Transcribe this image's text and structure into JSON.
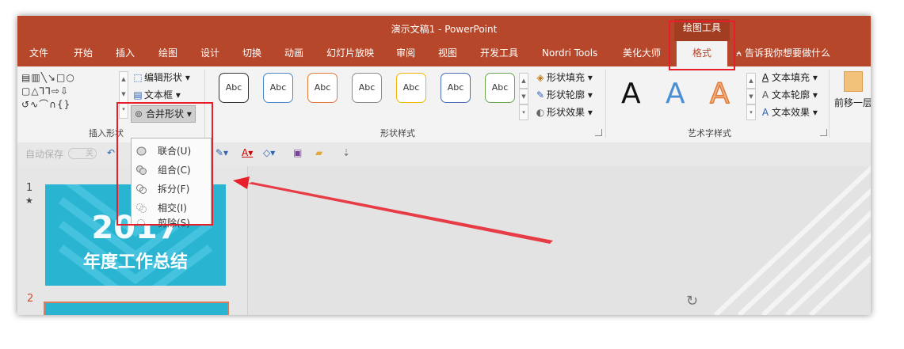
{
  "window": {
    "title": "演示文稿1  -  PowerPoint",
    "tools_header": "绘图工具"
  },
  "tabs": [
    "文件",
    "开始",
    "插入",
    "绘图",
    "设计",
    "切换",
    "动画",
    "幻灯片放映",
    "审阅",
    "视图",
    "开发工具",
    "Nordri Tools",
    "美化大师",
    "格式"
  ],
  "active_tab": "格式",
  "tell_me": "告诉我你想要做什么",
  "ribbon": {
    "insert_shapes": {
      "label": "插入形状",
      "edit_shape": "编辑形状",
      "text_box": "文本框",
      "merge_shapes": "合并形状"
    },
    "shape_styles": {
      "label": "形状样式",
      "sample": "Abc",
      "fill": "形状填充",
      "outline": "形状轮廓",
      "effects": "形状效果",
      "swatches": [
        "#333333",
        "#4a86c8",
        "#e07b39",
        "#8c8c8c",
        "#f2b600",
        "#4a6fb5",
        "#6aa84f"
      ]
    },
    "wordart_styles": {
      "label": "艺术字样式",
      "sample": "A",
      "text_fill": "文本填充",
      "text_outline": "文本轮廓",
      "text_effects": "文本效果"
    },
    "arrange": {
      "bring_forward": "前移一层"
    }
  },
  "qat": {
    "autosave": "自动保存",
    "toggle": "关"
  },
  "merge_menu": [
    {
      "label": "联合(U)"
    },
    {
      "label": "组合(C)"
    },
    {
      "label": "拆分(F)"
    },
    {
      "label": "相交(I)"
    },
    {
      "label": "剪除(S)"
    }
  ],
  "slides": [
    {
      "number": "1",
      "year": "2017",
      "subtitle": "年度工作总结"
    },
    {
      "number": "2"
    }
  ],
  "colors": {
    "accent": "#b7472a",
    "highlight": "#e81f2a",
    "slide_bg": "#29b5d2"
  }
}
